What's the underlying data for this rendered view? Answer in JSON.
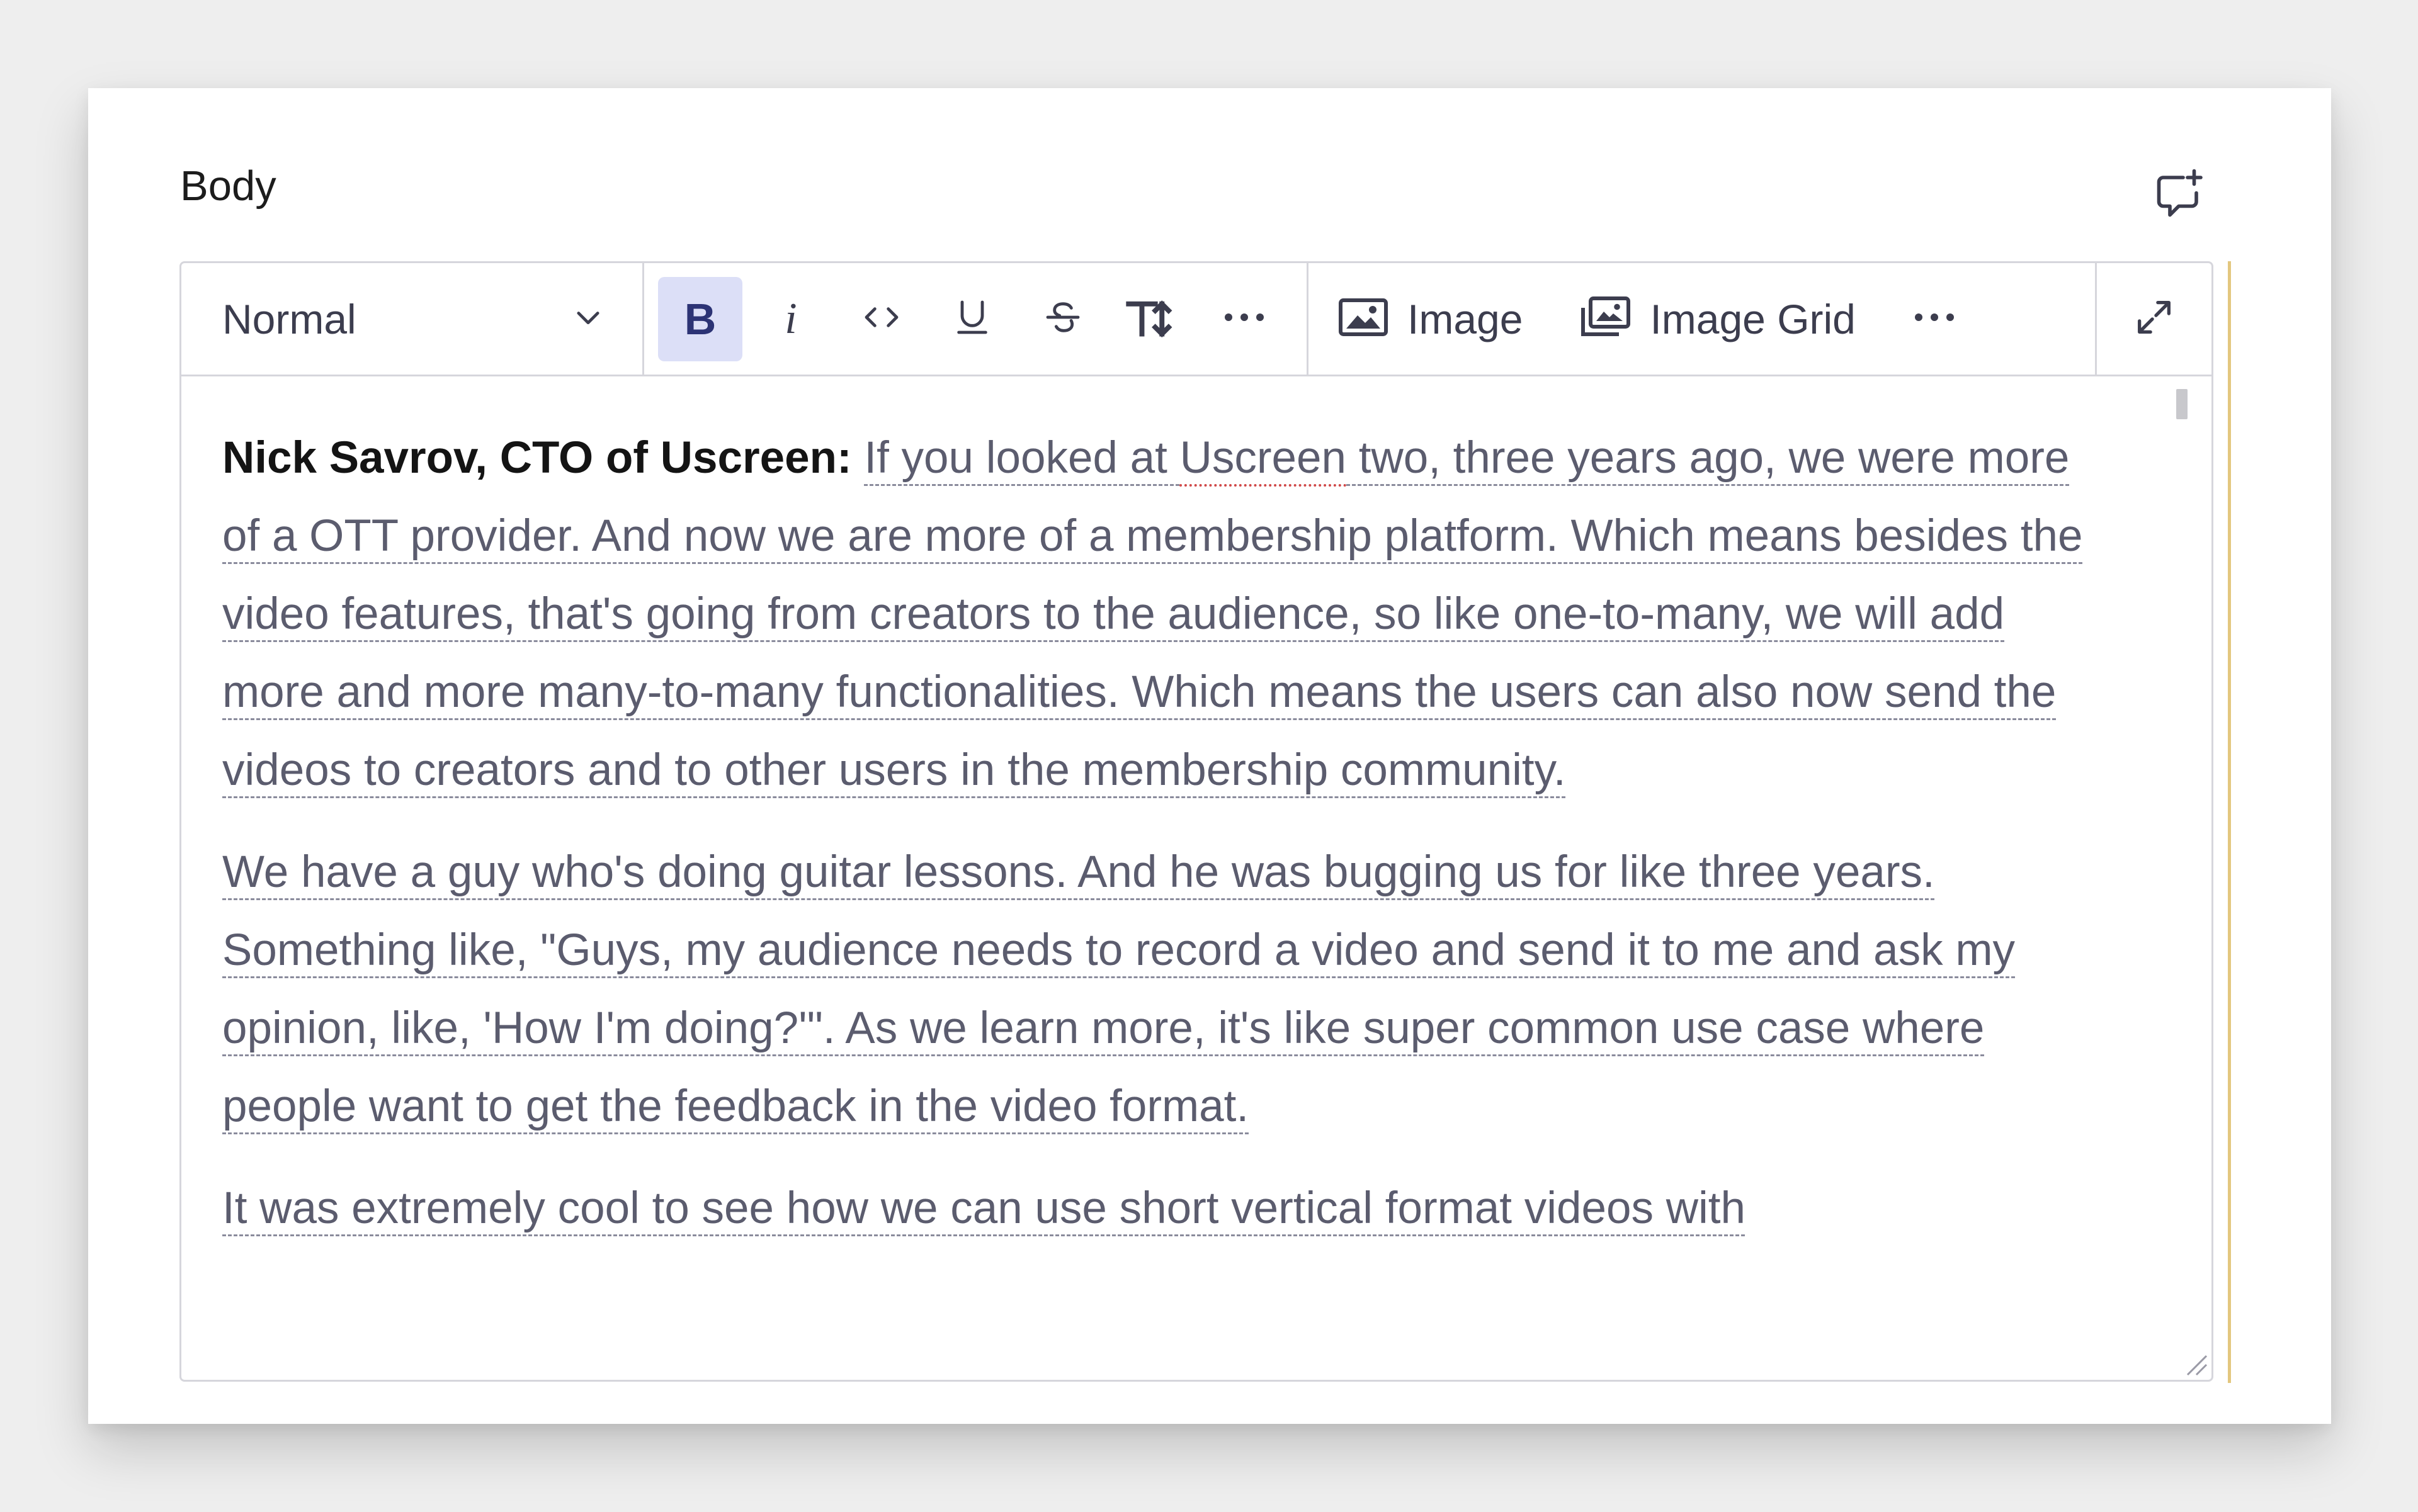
{
  "field": {
    "label": "Body",
    "comment_icon": "comment-add-icon"
  },
  "toolbar": {
    "block_type": "Normal",
    "format_buttons": [
      {
        "name": "bold",
        "glyph": "B",
        "active": true
      },
      {
        "name": "italic",
        "glyph": "i",
        "active": false
      },
      {
        "name": "code",
        "glyph": "<>",
        "active": false
      },
      {
        "name": "underline",
        "glyph": "U",
        "active": false
      },
      {
        "name": "strikethrough",
        "glyph": "S",
        "active": false
      },
      {
        "name": "text-size",
        "glyph": "TT",
        "active": false
      },
      {
        "name": "more-formatting",
        "glyph": "...",
        "active": false
      }
    ],
    "image_label": "Image",
    "image_grid_label": "Image Grid",
    "accent_color": "#dcdff7"
  },
  "content": {
    "paragraph1": {
      "speaker": "Nick Savrov, CTO of Uscreen:",
      "text_a": "If you looked at ",
      "misspelled": "Uscreen",
      "text_b": " two, three years ago, we were more of a OTT provider. And now we are more of a membership platform. Which means besides the video features, that's going from creators to the audience, so like one-to-many, we will add more and more many-to-many functionalities. Which means the users can also now send the videos to creators and to other users in the membership community."
    },
    "paragraph2": "We have a guy who's doing guitar lessons. And he was bugging us for like three years. Something like, \"Guys, my audience needs to record a video and send it to me and ask my opinion, like, 'How I'm doing?'\". As we learn more, it's like super common use case where people want to get the feedback in the video format.",
    "paragraph3": "It was extremely cool to see how we can use short vertical format videos with"
  }
}
